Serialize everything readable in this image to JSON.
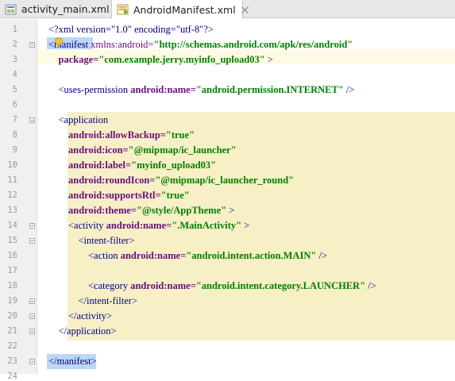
{
  "tabs": [
    {
      "label": "activity_main.xml",
      "active": false,
      "icon": "layout-xml-icon"
    },
    {
      "label": "AndroidManifest.xml",
      "active": true,
      "icon": "manifest-xml-icon"
    }
  ],
  "colors": {
    "tag": "#000080",
    "attribute": "#660e7a",
    "value": "#008000",
    "tag_match_highlight": "#bcd7f5",
    "scope_highlight": "#f7efc6",
    "current_line": "#fffae3"
  },
  "lines": [
    {
      "n": "1",
      "code": [
        [
          "tg",
          "<?xml version=\"1.0\" encoding=\"utf-8\"?>"
        ]
      ]
    },
    {
      "n": "2",
      "code": [
        [
          "tg",
          "<manifest "
        ],
        [
          "ns",
          "xmlns:android="
        ],
        [
          "av",
          "\"http://schemas.android.com/apk/res/android\""
        ]
      ]
    },
    {
      "n": "3",
      "code": [
        [
          "tg",
          "    "
        ],
        [
          "an",
          "package="
        ],
        [
          "av",
          "\"com.example.jerry.myinfo_upload03\""
        ],
        [
          "tg",
          " >"
        ]
      ]
    },
    {
      "n": "4",
      "code": []
    },
    {
      "n": "5",
      "code": [
        [
          "tg",
          "    <uses-permission "
        ],
        [
          "an",
          "android:name="
        ],
        [
          "av",
          "\"android.permission.INTERNET\""
        ],
        [
          "tg",
          " />"
        ]
      ]
    },
    {
      "n": "6",
      "code": []
    },
    {
      "n": "7",
      "code": [
        [
          "tg",
          "    <application"
        ]
      ]
    },
    {
      "n": "8",
      "code": [
        [
          "tg",
          "        "
        ],
        [
          "an",
          "android:allowBackup="
        ],
        [
          "av",
          "\"true\""
        ]
      ]
    },
    {
      "n": "9",
      "code": [
        [
          "tg",
          "        "
        ],
        [
          "an",
          "android:icon="
        ],
        [
          "av",
          "\"@mipmap/ic_launcher\""
        ]
      ]
    },
    {
      "n": "10",
      "code": [
        [
          "tg",
          "        "
        ],
        [
          "an",
          "android:label="
        ],
        [
          "av",
          "\"myinfo_upload03\""
        ]
      ]
    },
    {
      "n": "11",
      "code": [
        [
          "tg",
          "        "
        ],
        [
          "an",
          "android:roundIcon="
        ],
        [
          "av",
          "\"@mipmap/ic_launcher_round\""
        ]
      ]
    },
    {
      "n": "12",
      "code": [
        [
          "tg",
          "        "
        ],
        [
          "an",
          "android:supportsRtl="
        ],
        [
          "av",
          "\"true\""
        ]
      ]
    },
    {
      "n": "13",
      "code": [
        [
          "tg",
          "        "
        ],
        [
          "an",
          "android:theme="
        ],
        [
          "av",
          "\"@style/AppTheme\""
        ],
        [
          "tg",
          " >"
        ]
      ]
    },
    {
      "n": "14",
      "code": [
        [
          "tg",
          "        <activity "
        ],
        [
          "an",
          "android:name="
        ],
        [
          "av",
          "\".MainActivity\""
        ],
        [
          "tg",
          " >"
        ]
      ]
    },
    {
      "n": "15",
      "code": [
        [
          "tg",
          "            <intent-filter>"
        ]
      ]
    },
    {
      "n": "16",
      "code": [
        [
          "tg",
          "                <action "
        ],
        [
          "an",
          "android:name="
        ],
        [
          "av",
          "\"android.intent.action.MAIN\""
        ],
        [
          "tg",
          " />"
        ]
      ]
    },
    {
      "n": "17",
      "code": []
    },
    {
      "n": "18",
      "code": [
        [
          "tg",
          "                <category "
        ],
        [
          "an",
          "android:name="
        ],
        [
          "av",
          "\"android.intent.category.LAUNCHER\""
        ],
        [
          "tg",
          " />"
        ]
      ]
    },
    {
      "n": "19",
      "code": [
        [
          "tg",
          "            </intent-filter>"
        ]
      ]
    },
    {
      "n": "20",
      "code": [
        [
          "tg",
          "        </activity>"
        ]
      ]
    },
    {
      "n": "21",
      "code": [
        [
          "tg",
          "    </application>"
        ]
      ]
    },
    {
      "n": "22",
      "code": []
    },
    {
      "n": "23",
      "code": [
        [
          "tg",
          "</manifest>"
        ]
      ]
    },
    {
      "n": "24",
      "code": []
    }
  ]
}
